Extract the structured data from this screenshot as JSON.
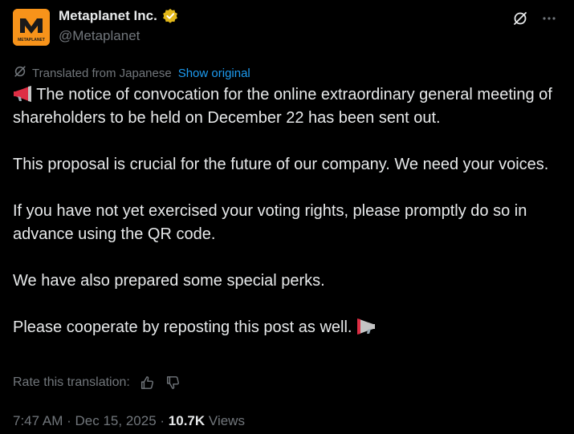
{
  "author": {
    "name": "Metaplanet Inc.",
    "handle": "@Metaplanet",
    "avatar_text": "METAPLANET",
    "verified_color": "#e2b719",
    "avatar_color": "#f7931a"
  },
  "translation": {
    "label": "Translated from Japanese",
    "show_original": "Show original"
  },
  "post": {
    "paragraphs": [
      "The notice of convocation for the online extraordinary general meeting of shareholders to be held on December 22 has been sent out.",
      "This proposal is crucial for the future of our company. We need your voices.",
      "If you have not yet exercised your voting rights, please promptly do so in advance using the QR code.",
      "We have also prepared some special perks.",
      "Please cooperate by reposting this post as well."
    ]
  },
  "rate": {
    "label": "Rate this translation:"
  },
  "meta": {
    "time": "7:47 AM",
    "sep1": "·",
    "date": "Dec 15, 2025",
    "sep2": "·",
    "views_count": "10.7K",
    "views_label": "Views"
  },
  "icons": {
    "top_right": [
      "grok-icon",
      "more-icon"
    ],
    "translate": "translate-icon",
    "rate": [
      "thumbs-up-icon",
      "thumbs-down-icon"
    ],
    "emoji": "megaphone-icon"
  }
}
